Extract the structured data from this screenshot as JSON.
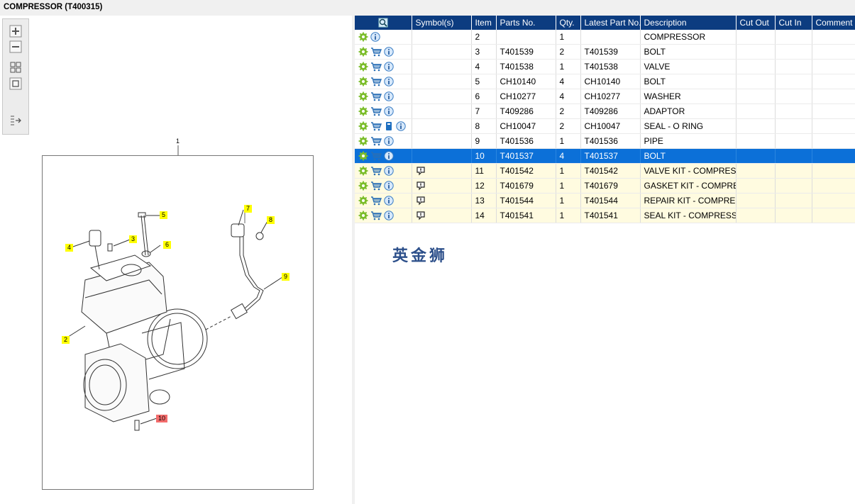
{
  "header": {
    "title": "COMPRESSOR (T400315)"
  },
  "drawing": {
    "top_label": "1",
    "callouts": [
      {
        "id": "c2",
        "label": "2"
      },
      {
        "id": "c3",
        "label": "3"
      },
      {
        "id": "c4",
        "label": "4"
      },
      {
        "id": "c5",
        "label": "5"
      },
      {
        "id": "c6",
        "label": "6"
      },
      {
        "id": "c7",
        "label": "7"
      },
      {
        "id": "c8",
        "label": "8"
      },
      {
        "id": "c9",
        "label": "9"
      },
      {
        "id": "c10",
        "label": "10"
      }
    ]
  },
  "toolbar": {
    "icons": [
      "zoom-in-icon",
      "zoom-out-icon",
      "fit-all-icon",
      "fit-page-icon",
      "export-icon"
    ]
  },
  "table": {
    "columns": [
      "",
      "Symbol(s)",
      "Item",
      "Parts No.",
      "Qty.",
      "Latest Part No.",
      "Description",
      "Cut Out",
      "Cut In",
      "Comment"
    ],
    "rows": [
      {
        "icons": [
          "gear",
          "info"
        ],
        "symbol": "",
        "item": "2",
        "part": "",
        "qty": "1",
        "latest": "",
        "desc": "COMPRESSOR",
        "style": "normal"
      },
      {
        "icons": [
          "gear",
          "cart",
          "info"
        ],
        "symbol": "",
        "item": "3",
        "part": "T401539",
        "qty": "2",
        "latest": "T401539",
        "desc": "BOLT",
        "style": "normal"
      },
      {
        "icons": [
          "gear",
          "cart",
          "info"
        ],
        "symbol": "",
        "item": "4",
        "part": "T401538",
        "qty": "1",
        "latest": "T401538",
        "desc": "VALVE",
        "style": "normal"
      },
      {
        "icons": [
          "gear",
          "cart",
          "info"
        ],
        "symbol": "",
        "item": "5",
        "part": "CH10140",
        "qty": "4",
        "latest": "CH10140",
        "desc": "BOLT",
        "style": "normal"
      },
      {
        "icons": [
          "gear",
          "cart",
          "info"
        ],
        "symbol": "",
        "item": "6",
        "part": "CH10277",
        "qty": "4",
        "latest": "CH10277",
        "desc": "WASHER",
        "style": "normal"
      },
      {
        "icons": [
          "gear",
          "cart",
          "info"
        ],
        "symbol": "",
        "item": "7",
        "part": "T409286",
        "qty": "2",
        "latest": "T409286",
        "desc": "ADAPTOR",
        "style": "normal"
      },
      {
        "icons": [
          "gear",
          "cart",
          "doc",
          "info"
        ],
        "symbol": "",
        "item": "8",
        "part": "CH10047",
        "qty": "2",
        "latest": "CH10047",
        "desc": "SEAL - O RING",
        "style": "normal"
      },
      {
        "icons": [
          "gear",
          "cart",
          "info"
        ],
        "symbol": "",
        "item": "9",
        "part": "T401536",
        "qty": "1",
        "latest": "T401536",
        "desc": "PIPE",
        "style": "normal"
      },
      {
        "icons": [
          "gear",
          "cart",
          "info"
        ],
        "symbol": "",
        "item": "10",
        "part": "T401537",
        "qty": "4",
        "latest": "T401537",
        "desc": "BOLT",
        "style": "selected"
      },
      {
        "icons": [
          "gear",
          "cart",
          "info"
        ],
        "symbol": "kit",
        "item": "11",
        "part": "T401542",
        "qty": "1",
        "latest": "T401542",
        "desc": "VALVE KIT - COMPRESSOR",
        "style": "yellow"
      },
      {
        "icons": [
          "gear",
          "cart",
          "info"
        ],
        "symbol": "kit",
        "item": "12",
        "part": "T401679",
        "qty": "1",
        "latest": "T401679",
        "desc": "GASKET KIT - COMPRESSOR",
        "style": "yellow"
      },
      {
        "icons": [
          "gear",
          "cart",
          "info"
        ],
        "symbol": "kit",
        "item": "13",
        "part": "T401544",
        "qty": "1",
        "latest": "T401544",
        "desc": "REPAIR KIT - COMPRESSOR",
        "style": "yellow"
      },
      {
        "icons": [
          "gear",
          "cart",
          "info"
        ],
        "symbol": "kit",
        "item": "14",
        "part": "T401541",
        "qty": "1",
        "latest": "T401541",
        "desc": "SEAL KIT - COMPRESSOR",
        "style": "yellow"
      }
    ]
  },
  "watermark": "英金狮",
  "colors": {
    "header_bg": "#0c3c80",
    "selected_bg": "#0c70d8",
    "kit_row_bg": "#fffbe0",
    "callout": "#ffff00",
    "callout_selected": "#f36c6c"
  }
}
